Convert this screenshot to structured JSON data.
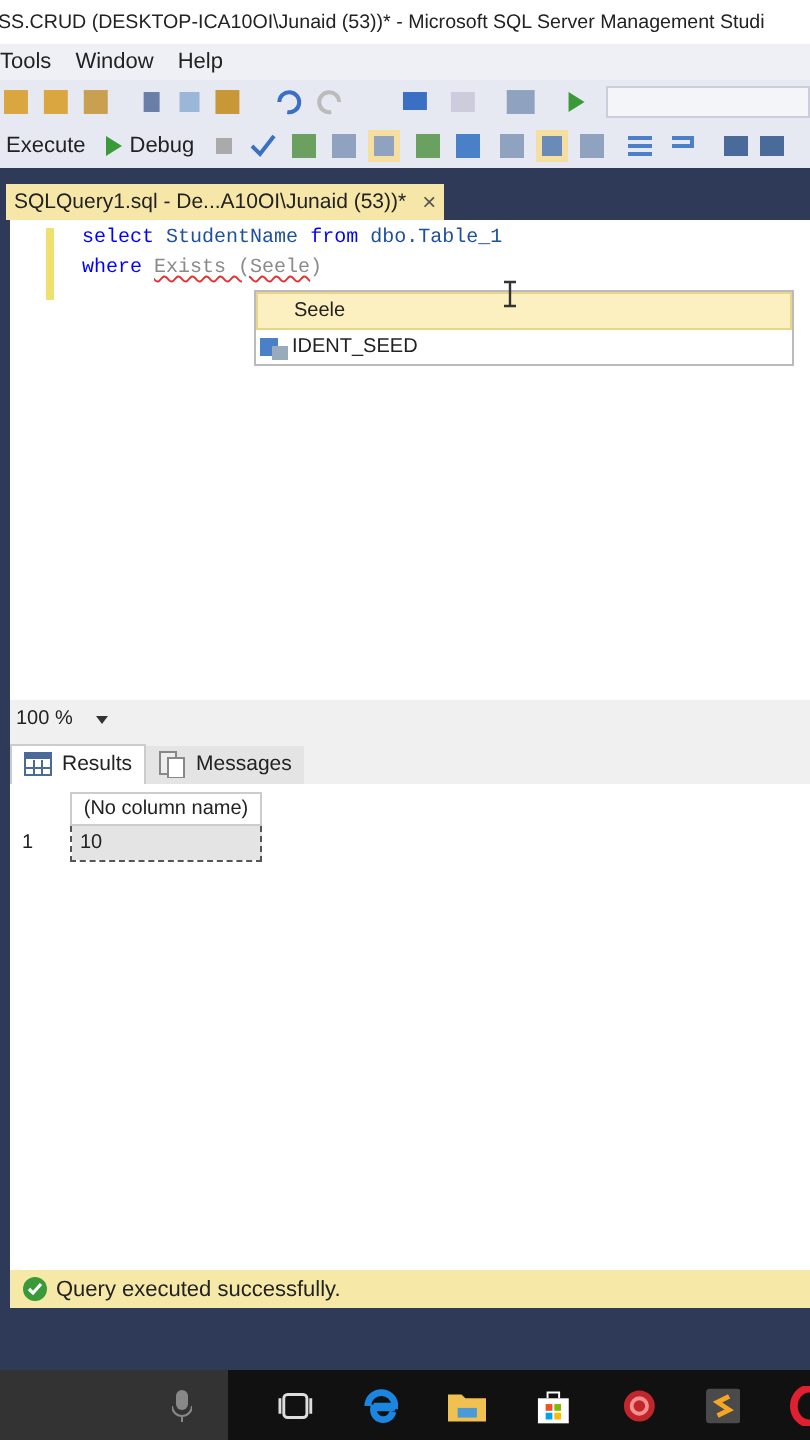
{
  "window": {
    "title": "SS.CRUD (DESKTOP-ICA10OI\\Junaid (53))* - Microsoft SQL Server Management Studi"
  },
  "menu": [
    "Tools",
    "Window",
    "Help"
  ],
  "toolbar": {
    "execute": "Execute",
    "debug": "Debug"
  },
  "document_tab": {
    "label": "SQLQuery1.sql - De...A10OI\\Junaid (53))*",
    "close": "×",
    "selected": true
  },
  "code_lines": [
    {
      "tokens": [
        {
          "text": "select",
          "kind": "keyword"
        },
        {
          "text": "StudentName",
          "kind": "ident"
        },
        {
          "text": "from",
          "kind": "keyword"
        },
        {
          "text": "dbo.Table_1",
          "kind": "ident"
        }
      ]
    },
    {
      "tokens": [
        {
          "text": "where",
          "kind": "keyword"
        },
        {
          "text": "Exists (Seele",
          "kind": "error"
        },
        {
          "text": ")",
          "kind": "plain"
        }
      ]
    }
  ],
  "autocomplete": [
    {
      "label": "Seele",
      "selected": true,
      "kind": "text"
    },
    {
      "label": "IDENT_SEED",
      "selected": false,
      "kind": "function"
    }
  ],
  "zoom": "100 %",
  "result_tabs": [
    {
      "label": "Results",
      "selected": true,
      "kind": "grid"
    },
    {
      "label": "Messages",
      "selected": false,
      "kind": "messages"
    }
  ],
  "grid": {
    "columns": [
      "(No column name)"
    ],
    "rows": [
      {
        "number": "1",
        "cells": [
          "10"
        ]
      }
    ]
  },
  "status": "Query executed successfully."
}
